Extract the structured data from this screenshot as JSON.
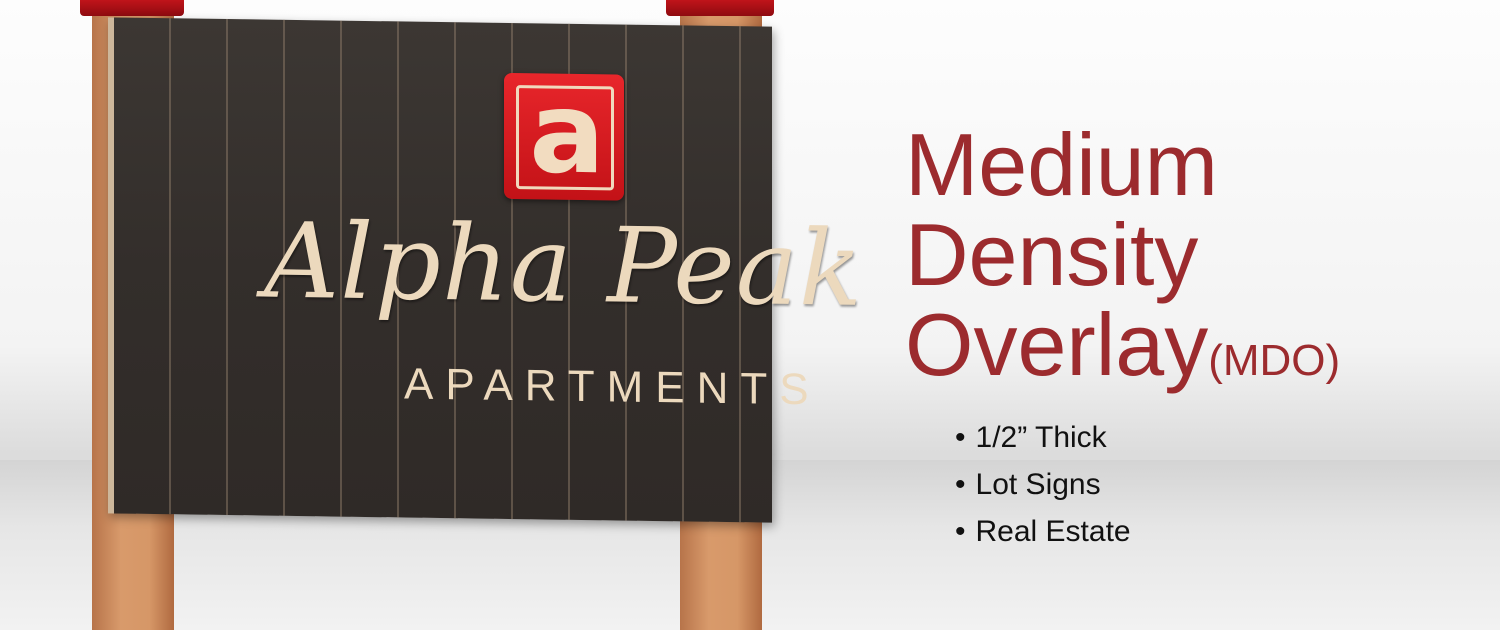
{
  "product": {
    "title_lines": [
      "Medium",
      "Density",
      "Overlay"
    ],
    "abbreviation": "(MDO)",
    "features": [
      "1/2” Thick",
      "Lot Signs",
      "Real Estate"
    ]
  },
  "sign_mockup": {
    "logo_letter": "a",
    "script_text": "Alpha Peak",
    "sub_text": "APARTMENTS"
  },
  "colors": {
    "heading": "#9c2b2e",
    "sign_background": "#332e2b",
    "logo_red": "#d81c21",
    "post_wood": "#d69767",
    "cap_red": "#b01218"
  }
}
